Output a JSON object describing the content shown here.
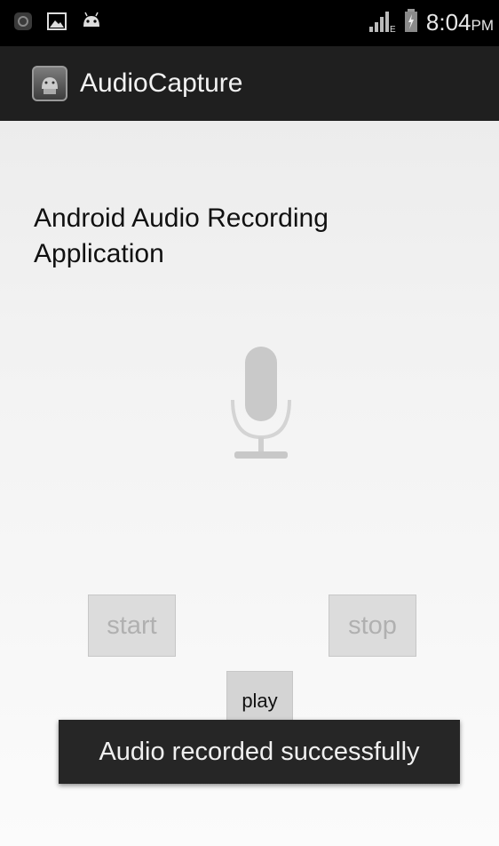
{
  "status_bar": {
    "time": "8:04",
    "ampm": "PM",
    "left_icons": [
      "notification-icon",
      "image-icon",
      "android-icon"
    ],
    "right_icons": [
      "signal-icon",
      "battery-icon"
    ]
  },
  "app_bar": {
    "icon": "android-app-icon",
    "title": "AudioCapture"
  },
  "main": {
    "heading": "Android Audio Recording Application",
    "mic_icon": "microphone-icon",
    "start_label": "start",
    "stop_label": "stop",
    "play_label": "play"
  },
  "toast": {
    "message": "Audio recorded successfully"
  },
  "colors": {
    "status_bar": "#000000",
    "app_bar": "#1f1f1f",
    "toast": "#262626",
    "disabled_text": "#b0b0b0"
  }
}
